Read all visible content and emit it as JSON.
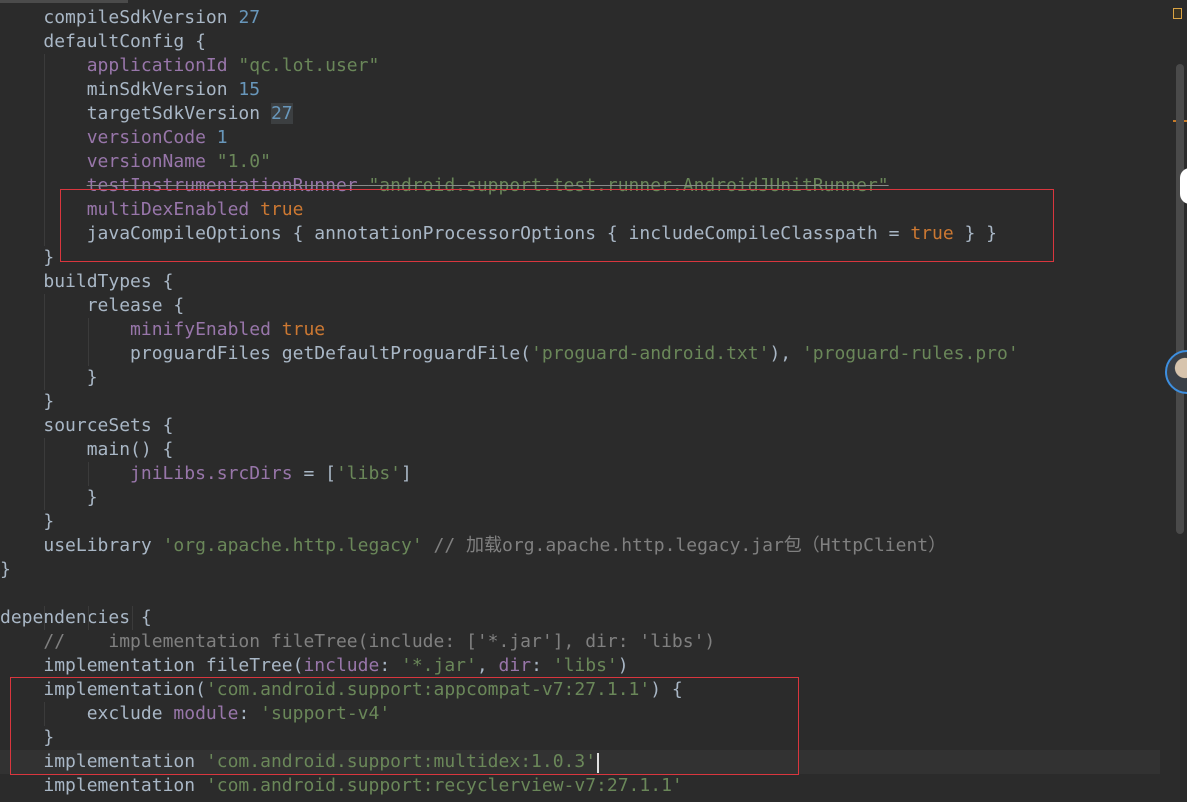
{
  "editor": {
    "lines": [
      [
        [
          "    ",
          ""
        ],
        [
          "compileSdkVersion ",
          ""
        ],
        [
          "27",
          "num"
        ]
      ],
      [
        [
          "    ",
          ""
        ],
        [
          "defaultConfig {",
          ""
        ]
      ],
      [
        [
          "        ",
          ""
        ],
        [
          "applicationId ",
          "prop"
        ],
        [
          "\"qc.lot.user\"",
          "str"
        ]
      ],
      [
        [
          "        ",
          ""
        ],
        [
          "minSdkVersion ",
          ""
        ],
        [
          "15",
          "num"
        ]
      ],
      [
        [
          "        ",
          ""
        ],
        [
          "targetSdkVersion ",
          ""
        ],
        [
          "27",
          "num numhl"
        ]
      ],
      [
        [
          "        ",
          ""
        ],
        [
          "versionCode ",
          "prop"
        ],
        [
          "1",
          "num"
        ]
      ],
      [
        [
          "        ",
          ""
        ],
        [
          "versionName ",
          "prop"
        ],
        [
          "\"1.0\"",
          "str"
        ]
      ],
      [
        [
          "        ",
          ""
        ],
        [
          "testInstrumentationRunner ",
          "prop strike"
        ],
        [
          "\"android.support.test.runner.AndroidJUnitRunner\"",
          "str strike"
        ]
      ],
      [
        [
          "        ",
          ""
        ],
        [
          "multiDexEnabled ",
          "prop"
        ],
        [
          "true",
          "kw"
        ]
      ],
      [
        [
          "        ",
          ""
        ],
        [
          "javaCompileOptions { annotationProcessorOptions { includeCompileClasspath = ",
          ""
        ],
        [
          "true",
          "kw"
        ],
        [
          " } }",
          ""
        ]
      ],
      [
        [
          "    ",
          ""
        ],
        [
          "}",
          ""
        ]
      ],
      [
        [
          "    ",
          ""
        ],
        [
          "buildTypes {",
          ""
        ]
      ],
      [
        [
          "        ",
          ""
        ],
        [
          "release {",
          ""
        ]
      ],
      [
        [
          "            ",
          ""
        ],
        [
          "minifyEnabled ",
          "prop"
        ],
        [
          "true",
          "kw"
        ]
      ],
      [
        [
          "            ",
          ""
        ],
        [
          "proguardFiles getDefaultProguardFile(",
          ""
        ],
        [
          "'proguard-android.txt'",
          "str"
        ],
        [
          "), ",
          ""
        ],
        [
          "'proguard-rules.pro'",
          "str"
        ]
      ],
      [
        [
          "        ",
          ""
        ],
        [
          "}",
          ""
        ]
      ],
      [
        [
          "    ",
          ""
        ],
        [
          "}",
          ""
        ]
      ],
      [
        [
          "    ",
          ""
        ],
        [
          "sourceSets {",
          ""
        ]
      ],
      [
        [
          "        ",
          ""
        ],
        [
          "main() {",
          ""
        ]
      ],
      [
        [
          "            ",
          ""
        ],
        [
          "jniLibs.srcDirs",
          "prop"
        ],
        [
          " = [",
          ""
        ],
        [
          "'libs'",
          "str"
        ],
        [
          "]",
          ""
        ]
      ],
      [
        [
          "        ",
          ""
        ],
        [
          "}",
          ""
        ]
      ],
      [
        [
          "    ",
          ""
        ],
        [
          "}",
          ""
        ]
      ],
      [
        [
          "    ",
          ""
        ],
        [
          "useLibrary ",
          ""
        ],
        [
          "'org.apache.http.legacy'",
          "str"
        ],
        [
          " // 加载org.apache.http.legacy.jar包（HttpClient）",
          "cmt"
        ]
      ],
      [
        [
          "}",
          ""
        ]
      ],
      [
        [
          "",
          ""
        ]
      ],
      [
        [
          "dependencies {",
          ""
        ]
      ],
      [
        [
          "    ",
          ""
        ],
        [
          "//    implementation fileTree(include: ['*.jar'], dir: 'libs')",
          "cmt"
        ]
      ],
      [
        [
          "    ",
          ""
        ],
        [
          "implementation fileTree(",
          ""
        ],
        [
          "include",
          "prop"
        ],
        [
          ": ",
          ""
        ],
        [
          "'*.jar'",
          "str"
        ],
        [
          ", ",
          ""
        ],
        [
          "dir",
          "prop"
        ],
        [
          ": ",
          ""
        ],
        [
          "'libs'",
          "str"
        ],
        [
          ")",
          ""
        ]
      ],
      [
        [
          "    ",
          ""
        ],
        [
          "implementation(",
          ""
        ],
        [
          "'com.android.support:appcompat-v7:27.1.1'",
          "str"
        ],
        [
          ") {",
          ""
        ]
      ],
      [
        [
          "        ",
          ""
        ],
        [
          "exclude ",
          ""
        ],
        [
          "module",
          "prop"
        ],
        [
          ": ",
          ""
        ],
        [
          "'support-v4'",
          "str"
        ]
      ],
      [
        [
          "    ",
          ""
        ],
        [
          "}",
          ""
        ]
      ],
      [
        [
          "    ",
          ""
        ],
        [
          "implementation ",
          ""
        ],
        [
          "'com.android.support:multidex:1.0.3'",
          "str"
        ]
      ],
      [
        [
          "    ",
          ""
        ],
        [
          "implementation ",
          ""
        ],
        [
          "'com.android.support:recyclerview-v7:27.1.1'",
          "str"
        ]
      ]
    ],
    "current_line": 31,
    "colors": {
      "background": "#2b2b2b",
      "keyword": "#cc7832",
      "string": "#6a8759",
      "number": "#6897bb",
      "property": "#9876aa",
      "comment": "#808080",
      "highlight_box": "#d9363e"
    }
  },
  "icons": {
    "avatar": "user-avatar-icon",
    "inspection": "error-stripe-icon"
  }
}
